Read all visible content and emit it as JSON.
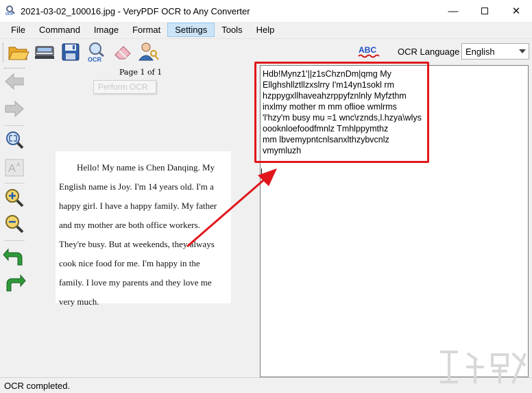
{
  "window": {
    "title": "2021-03-02_100016.jpg - VeryPDF OCR to Any Converter",
    "minimize": "—",
    "close": "✕"
  },
  "menu": [
    {
      "label": "File"
    },
    {
      "label": "Command"
    },
    {
      "label": "Image"
    },
    {
      "label": "Format"
    },
    {
      "label": "Settings",
      "active": true
    },
    {
      "label": "Tools"
    },
    {
      "label": "Help"
    }
  ],
  "toolbar": {
    "icons": [
      "open-folder-icon",
      "scanner-icon",
      "save-icon",
      "ocr-icon",
      "eraser-icon",
      "user-key-icon",
      "spellcheck-icon"
    ],
    "spellcheck_label": "ABC",
    "ocr_language_label": "OCR Language",
    "ocr_language_value": "English",
    "ocr_icon_label": "OCR"
  },
  "side_toolbar": {
    "icons": [
      "back-arrow-icon",
      "forward-arrow-icon",
      "fit-page-icon",
      "font-size-icon",
      "zoom-in-icon",
      "zoom-out-icon",
      "rotate-left-icon",
      "rotate-right-icon"
    ]
  },
  "image_pane": {
    "page_label": "Page 1 of 1",
    "perform_ocr_tooltip": "Perform OCR",
    "document_lines": [
      "Hello! My name is Chen Danqing. My",
      "English name is Joy. I'm 14 years old. I'm a",
      "happy girl. I have a happy family. My father",
      "and my mother are both office workers.",
      "They're busy. But at weekends, they always",
      "cook nice food for me. I'm happy in the",
      "family. I love my parents and they love me",
      "very much."
    ]
  },
  "text_pane": {
    "ocr_result": "Hdb!Mynz1'||z1sChznDm|qmg My\nEllghshllztllzxslrry I'm14yn1sokl rm\nhzppygxllhaveahzrppyfznlnly Myfzthm\ninxlmy mother m mm oflioe wmlrms\n'l'hzy'm busy mu =1 wnc\\rznds,l.hzya\\wlys\noooknloefoodfmnlz Tmhlppymthz\nmm lbvemypntcnlsanxlthzybvcnlz\nvmymluzh"
  },
  "status": {
    "message": "OCR completed."
  },
  "colors": {
    "highlight": "#e0161a",
    "menu_active_bg": "#cce4f7"
  }
}
